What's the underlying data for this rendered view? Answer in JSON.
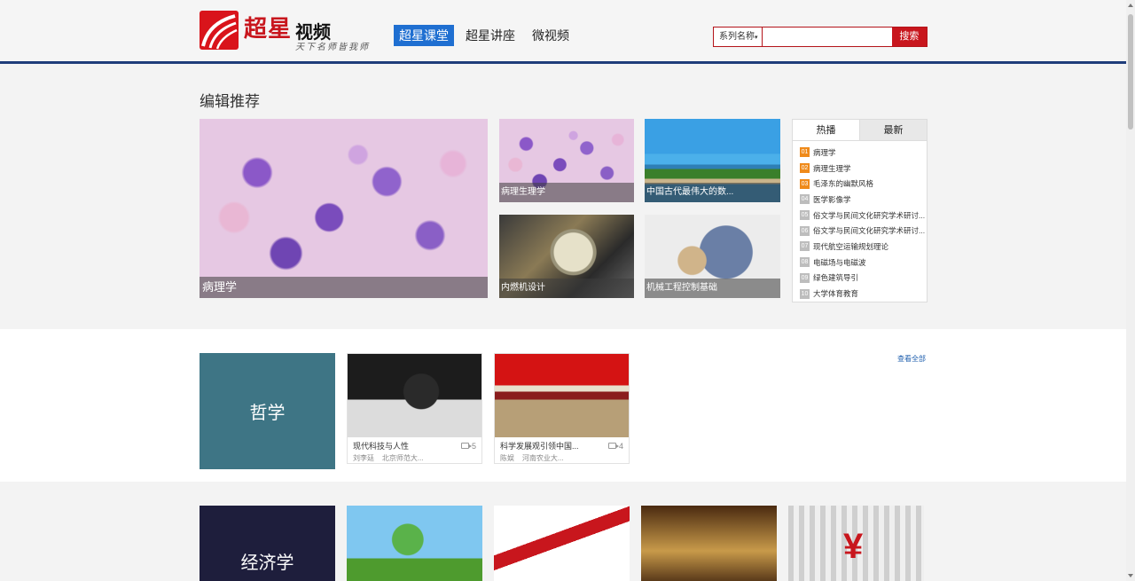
{
  "brand": {
    "name": "超星",
    "product": "视频",
    "slogan": "天下名师皆我师"
  },
  "nav": [
    {
      "label": "超星课堂",
      "active": true
    },
    {
      "label": "超星讲座",
      "active": false
    },
    {
      "label": "微视频",
      "active": false
    }
  ],
  "search": {
    "category": "系列名称",
    "value": "",
    "button": "搜索"
  },
  "editor": {
    "title": "编辑推荐",
    "featured": [
      {
        "caption": "病理学"
      },
      {
        "caption": "病理生理学"
      },
      {
        "caption": "中国古代最伟大的数..."
      },
      {
        "caption": "内燃机设计"
      },
      {
        "caption": "机械工程控制基础"
      }
    ]
  },
  "ranking": {
    "tabs": [
      "热播",
      "最新"
    ],
    "items": [
      {
        "num": "01",
        "title": "病理学"
      },
      {
        "num": "02",
        "title": "病理生理学"
      },
      {
        "num": "03",
        "title": "毛泽东的幽默风格"
      },
      {
        "num": "04",
        "title": "医学影像学"
      },
      {
        "num": "05",
        "title": "俗文学与民间文化研究学术研讨..."
      },
      {
        "num": "06",
        "title": "俗文学与民间文化研究学术研讨..."
      },
      {
        "num": "07",
        "title": "现代航空运输规划理论"
      },
      {
        "num": "08",
        "title": "电磁场与电磁波"
      },
      {
        "num": "09",
        "title": "绿色建筑导引"
      },
      {
        "num": "10",
        "title": "大学体育教育"
      }
    ]
  },
  "sections": [
    {
      "category": "哲学",
      "color": "#3e7585",
      "view_all": "查看全部",
      "courses": [
        {
          "title": "现代科技与人性",
          "count": "5",
          "author": "刘李廷",
          "school": "北京师范大..."
        },
        {
          "title": "科学发展观引领中国...",
          "count": "4",
          "author": "陈娱",
          "school": "河南农业大..."
        }
      ]
    },
    {
      "category": "经济学",
      "color": "#1e1e3c"
    }
  ]
}
